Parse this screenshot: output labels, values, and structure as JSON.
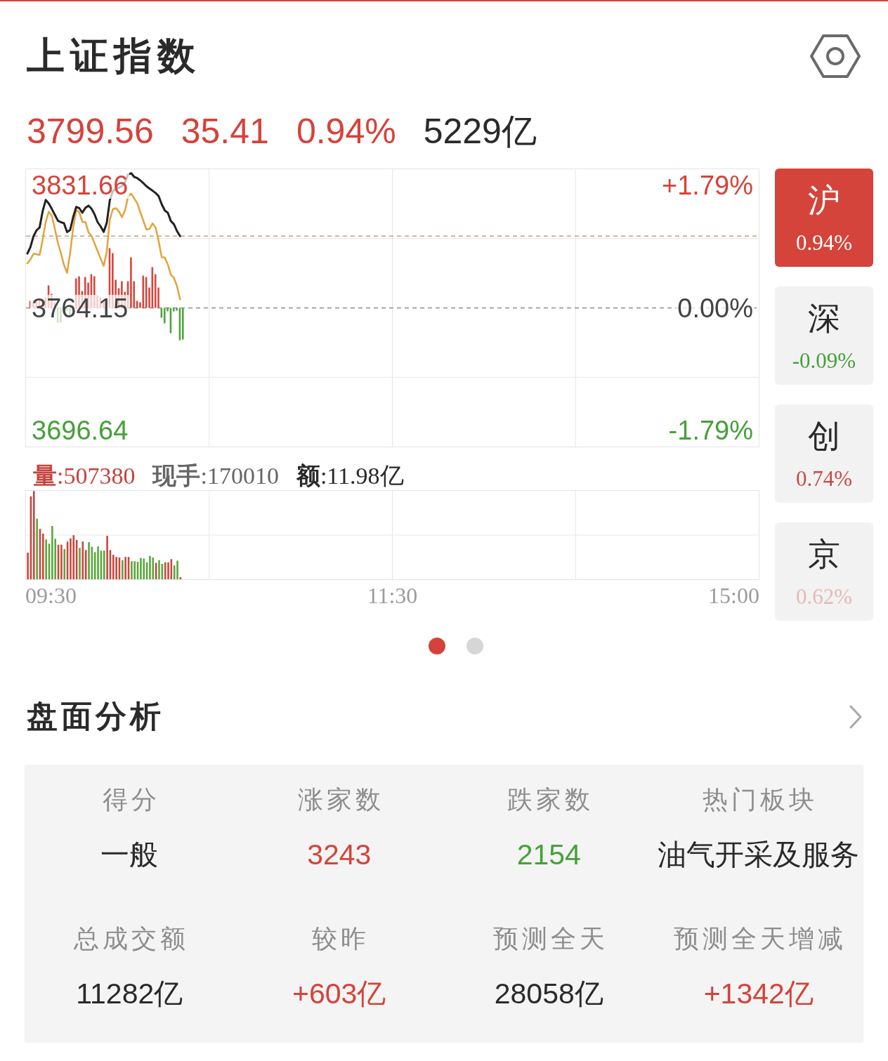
{
  "header": {
    "title": "上证指数"
  },
  "quote": [
    {
      "text": "3799.56",
      "color": "#d4433b"
    },
    {
      "text": "35.41",
      "color": "#d4433b"
    },
    {
      "text": "0.94%",
      "color": "#d4433b"
    },
    {
      "text": "5229亿",
      "color": "#2a2a2a"
    }
  ],
  "chart": {
    "y_labels": [
      {
        "text": "3831.66",
        "color": "#d4433b"
      },
      {
        "text": "3764.15",
        "color": "#444444"
      },
      {
        "text": "3696.64",
        "color": "#46a03a"
      }
    ],
    "pct_labels": [
      {
        "text": "+1.79%",
        "color": "#d4433b"
      },
      {
        "text": "0.00%",
        "color": "#444444"
      },
      {
        "text": "-1.79%",
        "color": "#46a03a"
      }
    ],
    "volume_stats": [
      {
        "text": "**量**:507380",
        "color": "#c4443d"
      },
      {
        "text": "**现手**:170010",
        "color": "#666666"
      },
      {
        "text": "**额**:11.98亿",
        "color": "#2a2a2a"
      }
    ],
    "time_labels": [
      "09:30",
      "11:30",
      "15:00"
    ]
  },
  "market_tabs": [
    {
      "label": "沪",
      "change": "0.94%",
      "color": "#d4443b",
      "selected": true
    },
    {
      "label": "深",
      "change": "-0.09%",
      "color": "#46a03a",
      "selected": false
    },
    {
      "label": "创",
      "change": "0.74%",
      "color": "#c64b45",
      "selected": false
    },
    {
      "label": "京",
      "change": "0.62%",
      "color": "#e6b9b6",
      "selected": false
    }
  ],
  "pager": [
    {
      "selected": true
    },
    {
      "selected": false
    }
  ],
  "analysis": {
    "title": "盘面分析",
    "cells": [
      {
        "label": "得分",
        "value": "一般",
        "color": "#2a2a2a"
      },
      {
        "label": "涨家数",
        "value": "3243",
        "color": "#d4433b"
      },
      {
        "label": "跌家数",
        "value": "2154",
        "color": "#46a03a"
      },
      {
        "label": "热门板块",
        "value": "油气开采及服务",
        "color": "#2a2a2a"
      },
      {
        "label": "总成交额",
        "value": "11282亿",
        "color": "#2a2a2a"
      },
      {
        "label": "较昨",
        "value": "+603亿",
        "color": "#d4433b"
      },
      {
        "label": "预测全天",
        "value": "28058亿",
        "color": "#2a2a2a"
      },
      {
        "label": "预测全天增减",
        "value": "+1342亿",
        "color": "#d4433b"
      }
    ]
  }
}
